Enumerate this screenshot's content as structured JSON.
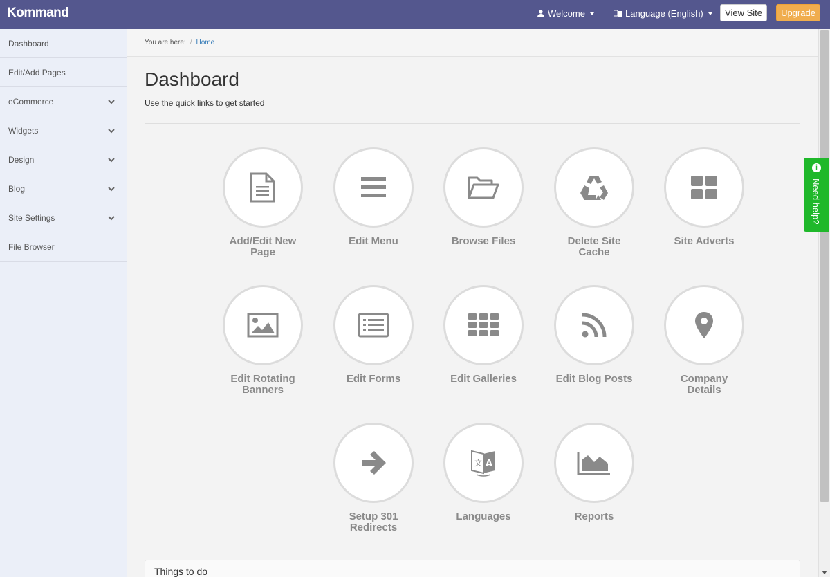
{
  "header": {
    "logo": "Kommand",
    "welcome": "Welcome",
    "language": "Language (English)",
    "view_site": "View Site",
    "upgrade": "Upgrade"
  },
  "sidebar": {
    "items": [
      {
        "label": "Dashboard",
        "has_chevron": false
      },
      {
        "label": "Edit/Add Pages",
        "has_chevron": false
      },
      {
        "label": "eCommerce",
        "has_chevron": true
      },
      {
        "label": "Widgets",
        "has_chevron": true
      },
      {
        "label": "Design",
        "has_chevron": true
      },
      {
        "label": "Blog",
        "has_chevron": true
      },
      {
        "label": "Site Settings",
        "has_chevron": true
      },
      {
        "label": "File Browser",
        "has_chevron": false
      }
    ]
  },
  "breadcrumb": {
    "prefix": "You are here:",
    "separator": "/",
    "home": "Home"
  },
  "main": {
    "title": "Dashboard",
    "subtitle": "Use the quick links to get started",
    "things_to_do": "Things to do"
  },
  "tiles": [
    {
      "label": "Add/Edit New Page",
      "icon": "document-icon"
    },
    {
      "label": "Edit Menu",
      "icon": "menu-icon"
    },
    {
      "label": "Browse Files",
      "icon": "folder-open-icon"
    },
    {
      "label": "Delete Site Cache",
      "icon": "recycle-icon"
    },
    {
      "label": "Site Adverts",
      "icon": "grid-large-icon"
    },
    {
      "label": "Edit Rotating Banners",
      "icon": "picture-icon"
    },
    {
      "label": "Edit Forms",
      "icon": "list-alt-icon"
    },
    {
      "label": "Edit Galleries",
      "icon": "grid-small-icon"
    },
    {
      "label": "Edit Blog Posts",
      "icon": "rss-icon"
    },
    {
      "label": "Company Details",
      "icon": "map-marker-icon"
    },
    {
      "label": "Setup 301 Redirects",
      "icon": "arrow-right-icon"
    },
    {
      "label": "Languages",
      "icon": "language-icon"
    },
    {
      "label": "Reports",
      "icon": "area-chart-icon"
    }
  ],
  "help": {
    "label": "Need help?",
    "icon": "info-icon"
  },
  "colors": {
    "topbar": "#54578e",
    "upgrade": "#f0ad4e",
    "help": "#1fb82a",
    "sidebar": "#ebeff8",
    "icon": "#8a8a8a"
  }
}
